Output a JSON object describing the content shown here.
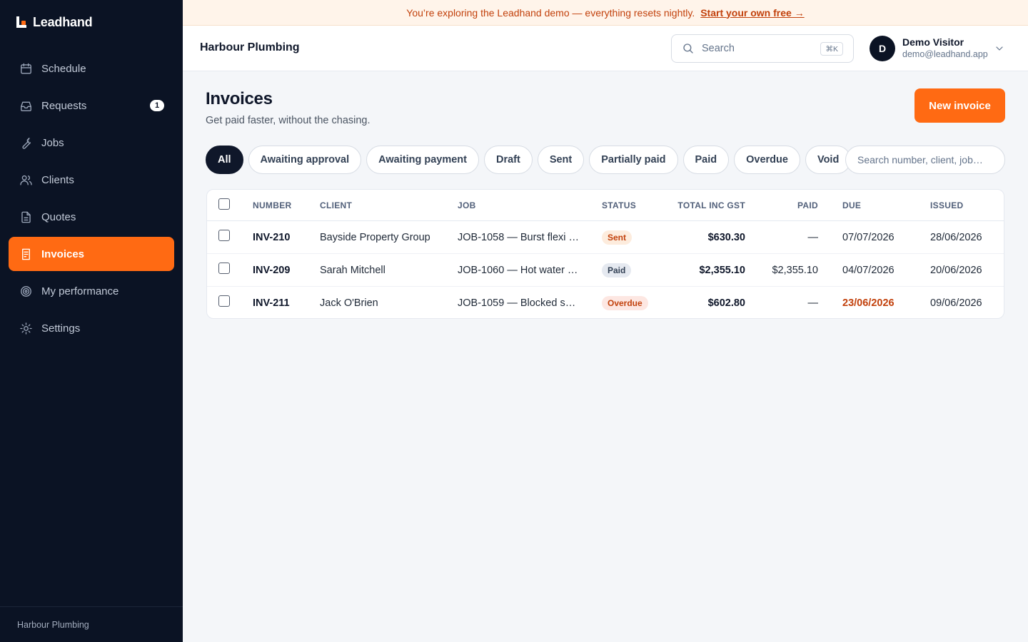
{
  "app": {
    "brand": "Leadhand",
    "org": "Harbour Plumbing"
  },
  "banner": {
    "text": "You’re exploring the Leadhand demo — everything resets nightly.",
    "link": "Start your own free →"
  },
  "sidebar": {
    "items": [
      {
        "label": "Schedule",
        "icon": "calendar-icon"
      },
      {
        "label": "Requests",
        "icon": "inbox-icon",
        "badge": "1"
      },
      {
        "label": "Jobs",
        "icon": "wrench-icon"
      },
      {
        "label": "Clients",
        "icon": "users-icon"
      },
      {
        "label": "Quotes",
        "icon": "document-icon"
      },
      {
        "label": "Invoices",
        "icon": "receipt-icon",
        "active": true
      },
      {
        "label": "My performance",
        "icon": "target-icon"
      },
      {
        "label": "Settings",
        "icon": "sun-icon"
      }
    ],
    "footer": "Harbour Plumbing"
  },
  "header": {
    "search_placeholder": "Search",
    "shortcut": "⌘K",
    "user": {
      "initial": "D",
      "name": "Demo Visitor",
      "email": "demo@leadhand.app"
    }
  },
  "page": {
    "title": "Invoices",
    "subtitle": "Get paid faster, without the chasing.",
    "new_button": "New invoice"
  },
  "filters": {
    "chips": [
      "All",
      "Awaiting approval",
      "Awaiting payment",
      "Draft",
      "Sent",
      "Partially paid",
      "Paid",
      "Overdue",
      "Void"
    ],
    "active": "All",
    "search_placeholder": "Search number, client, job…"
  },
  "table": {
    "columns": [
      "NUMBER",
      "CLIENT",
      "JOB",
      "STATUS",
      "TOTAL INC GST",
      "PAID",
      "DUE",
      "ISSUED"
    ],
    "rows": [
      {
        "number": "INV-210",
        "client": "Bayside Property Group",
        "job": "JOB-1058 — Burst flexi h…",
        "status": "Sent",
        "total": "$630.30",
        "paid": "—",
        "due": "07/07/2026",
        "issued": "28/06/2026"
      },
      {
        "number": "INV-209",
        "client": "Sarah Mitchell",
        "job": "JOB-1060 — Hot water s…",
        "status": "Paid",
        "total": "$2,355.10",
        "paid": "$2,355.10",
        "due": "04/07/2026",
        "issued": "20/06/2026"
      },
      {
        "number": "INV-211",
        "client": "Jack O'Brien",
        "job": "JOB-1059 — Blocked se…",
        "status": "Overdue",
        "total": "$602.80",
        "paid": "—",
        "due": "23/06/2026",
        "issued": "09/06/2026"
      }
    ]
  },
  "colors": {
    "accent": "#ff6a13",
    "sidebar": "#0b1324",
    "overdue": "#c2410c"
  }
}
